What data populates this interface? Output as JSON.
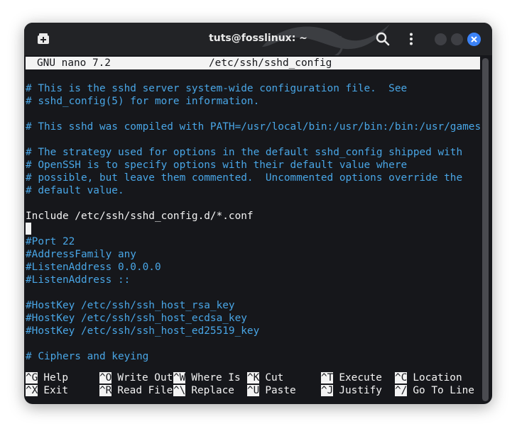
{
  "window": {
    "title": "tuts@fosslinux: ~"
  },
  "nano": {
    "version": "GNU nano 7.2",
    "filename": "/etc/ssh/sshd_config"
  },
  "lines": [
    {
      "text": "# This is the sshd server system-wide configuration file.  See",
      "type": "comment"
    },
    {
      "text": "# sshd_config(5) for more information.",
      "type": "comment"
    },
    {
      "text": "",
      "type": "blank"
    },
    {
      "text": "# This sshd was compiled with PATH=/usr/local/bin:/usr/bin:/bin:/usr/games",
      "type": "comment"
    },
    {
      "text": "",
      "type": "blank"
    },
    {
      "text": "# The strategy used for options in the default sshd_config shipped with",
      "type": "comment"
    },
    {
      "text": "# OpenSSH is to specify options with their default value where",
      "type": "comment"
    },
    {
      "text": "# possible, but leave them commented.  Uncommented options override the",
      "type": "comment"
    },
    {
      "text": "# default value.",
      "type": "comment"
    },
    {
      "text": "",
      "type": "blank"
    },
    {
      "text": "Include /etc/ssh/sshd_config.d/*.conf",
      "type": "text"
    },
    {
      "text": "",
      "type": "cursor"
    },
    {
      "text": "#Port 22",
      "type": "comment"
    },
    {
      "text": "#AddressFamily any",
      "type": "comment"
    },
    {
      "text": "#ListenAddress 0.0.0.0",
      "type": "comment"
    },
    {
      "text": "#ListenAddress ::",
      "type": "comment"
    },
    {
      "text": "",
      "type": "blank"
    },
    {
      "text": "#HostKey /etc/ssh/ssh_host_rsa_key",
      "type": "comment"
    },
    {
      "text": "#HostKey /etc/ssh/ssh_host_ecdsa_key",
      "type": "comment"
    },
    {
      "text": "#HostKey /etc/ssh/ssh_host_ed25519_key",
      "type": "comment"
    },
    {
      "text": "",
      "type": "blank"
    },
    {
      "text": "# Ciphers and keying",
      "type": "comment"
    }
  ],
  "shortcuts": [
    {
      "key": "^G",
      "label": "Help"
    },
    {
      "key": "^O",
      "label": "Write Out"
    },
    {
      "key": "^W",
      "label": "Where Is"
    },
    {
      "key": "^K",
      "label": "Cut"
    },
    {
      "key": "^T",
      "label": "Execute"
    },
    {
      "key": "^C",
      "label": "Location"
    },
    {
      "key": "^X",
      "label": "Exit"
    },
    {
      "key": "^R",
      "label": "Read File"
    },
    {
      "key": "^\\",
      "label": "Replace"
    },
    {
      "key": "^U",
      "label": "Paste"
    },
    {
      "key": "^J",
      "label": "Justify"
    },
    {
      "key": "^/",
      "label": "Go To Line"
    }
  ],
  "icons": {
    "new_tab": "new-tab-icon",
    "search": "search-icon",
    "menu": "kebab-menu-icon",
    "minimize": "minimize-icon",
    "maximize": "maximize-icon",
    "close": "close-icon",
    "watermark": "kali-dragon-icon"
  },
  "colors": {
    "terminal_bg": "#16171b",
    "titlebar_bg": "#222326",
    "comment": "#49a6e6",
    "text": "#f3f3f3",
    "close_button": "#3b82f6"
  }
}
